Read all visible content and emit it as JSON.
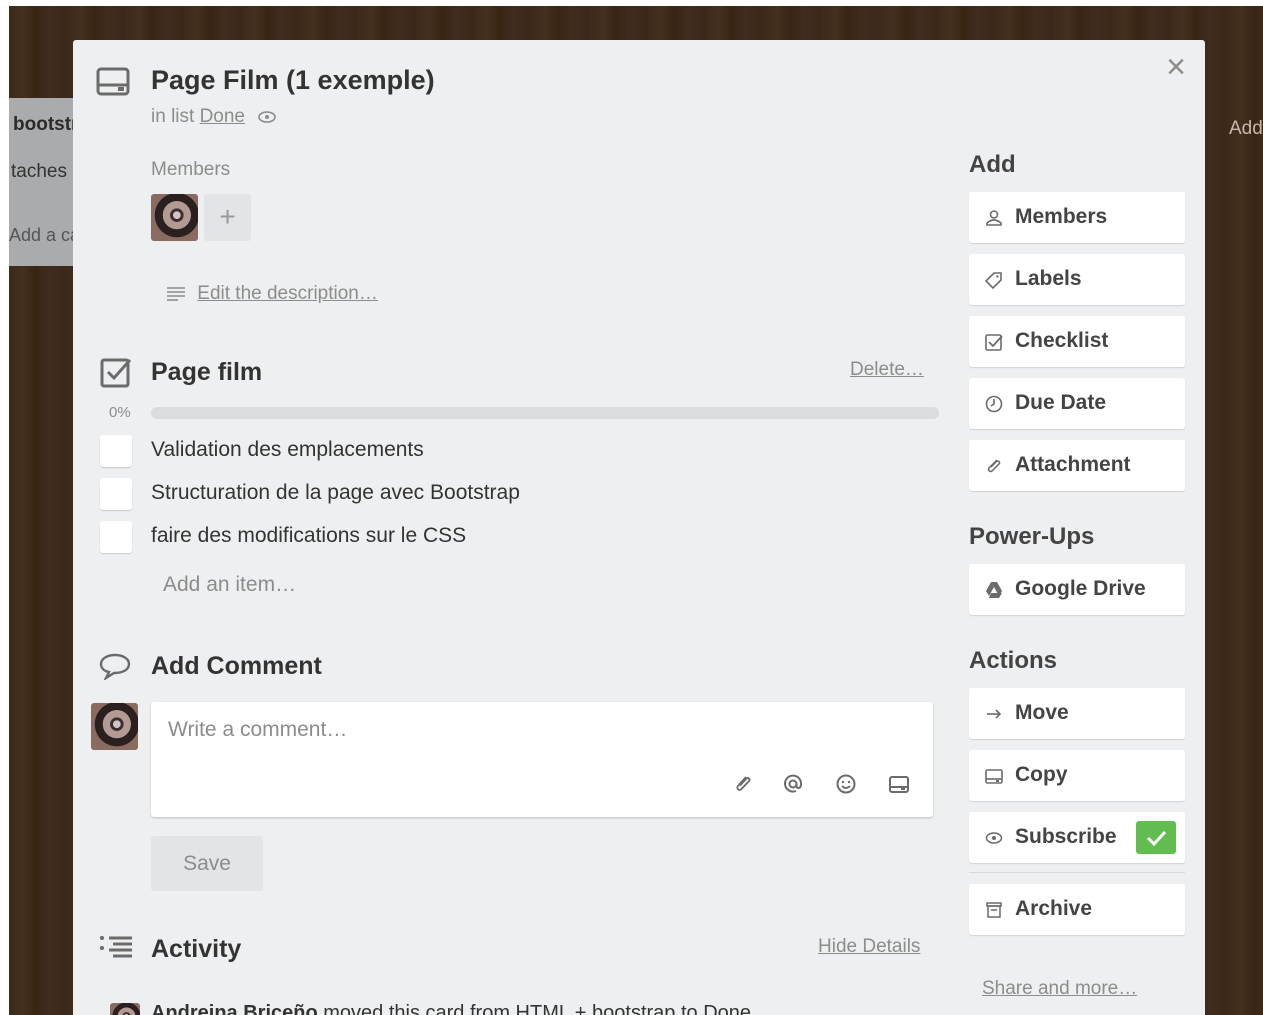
{
  "background": {
    "list_title": "bootstrap",
    "list_card": "taches",
    "list_add": "Add a card…",
    "right_text": "Add"
  },
  "card": {
    "title": "Page Film (1 exemple)",
    "in_list_prefix": "in list",
    "list_name": "Done",
    "members_label": "Members",
    "add_member": "+",
    "edit_description": "Edit the description…"
  },
  "checklist": {
    "title": "Page film",
    "delete_label": "Delete…",
    "progress_label": "0%",
    "progress_fraction": 0,
    "progress_color": "#61bd4f",
    "items": [
      {
        "text": "Validation des emplacements",
        "checked": false
      },
      {
        "text": "Structuration de la page avec Bootstrap",
        "checked": false
      },
      {
        "text": "faire des modifications sur le CSS",
        "checked": false
      }
    ],
    "add_item": "Add an item…"
  },
  "comment": {
    "title": "Add Comment",
    "placeholder": "Write a comment…",
    "save_label": "Save",
    "tools": [
      "attachment-icon",
      "mention-icon",
      "emoji-icon",
      "card-icon"
    ]
  },
  "activity": {
    "title": "Activity",
    "hide_details": "Hide Details",
    "entry_user": "Andreina Briceño",
    "entry_text": " moved this card from HTML + bootstrap to Done"
  },
  "sidebar": {
    "add_heading": "Add",
    "add_buttons": [
      {
        "label": "Members",
        "icon": "person-icon"
      },
      {
        "label": "Labels",
        "icon": "tag-icon"
      },
      {
        "label": "Checklist",
        "icon": "checklist-icon"
      },
      {
        "label": "Due Date",
        "icon": "clock-icon"
      },
      {
        "label": "Attachment",
        "icon": "paperclip-icon"
      }
    ],
    "powerups_heading": "Power-Ups",
    "powerups": [
      {
        "label": "Google Drive",
        "icon": "google-drive-icon"
      }
    ],
    "actions_heading": "Actions",
    "actions": [
      {
        "label": "Move",
        "icon": "arrow-right-icon"
      },
      {
        "label": "Copy",
        "icon": "card-icon"
      },
      {
        "label": "Subscribe",
        "icon": "eye-icon",
        "subscribed": true
      },
      {
        "label": "Archive",
        "icon": "archive-icon"
      }
    ],
    "share_more": "Share and more…",
    "subscribed_color": "#61bd4f"
  }
}
